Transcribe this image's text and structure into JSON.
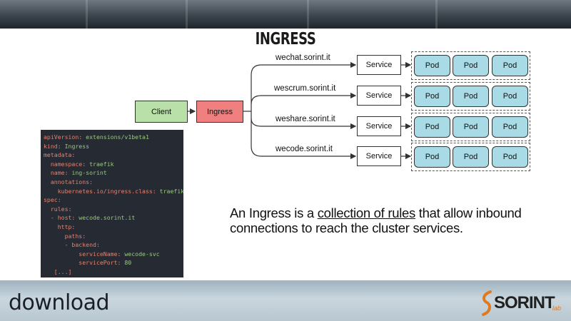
{
  "slide": {
    "title": "INGRESS",
    "description_before": "An Ingress is a ",
    "description_link": "collection of rules",
    "description_after": " that allow inbound connections to reach the cluster services."
  },
  "diagram": {
    "client_label": "Client",
    "ingress_label": "Ingress",
    "routes": [
      {
        "host": "wechat.sorint.it",
        "service": "Service",
        "pods": [
          "Pod",
          "Pod",
          "Pod"
        ]
      },
      {
        "host": "wescrum.sorint.it",
        "service": "Service",
        "pods": [
          "Pod",
          "Pod",
          "Pod"
        ]
      },
      {
        "host": "weshare.sorint.it",
        "service": "Service",
        "pods": [
          "Pod",
          "Pod",
          "Pod"
        ]
      },
      {
        "host": "wecode.sorint.it",
        "service": "Service",
        "pods": [
          "Pod",
          "Pod",
          "Pod"
        ]
      }
    ],
    "colors": {
      "client": "#b8e0a8",
      "ingress": "#f07f7f",
      "pod": "#a9dbe7"
    }
  },
  "yaml": [
    {
      "indent": "",
      "key": "apiVersion:",
      "value": " extensions/v1beta1"
    },
    {
      "indent": "",
      "key": "kind:",
      "value": " Ingress"
    },
    {
      "indent": "",
      "key": "metadata:",
      "value": ""
    },
    {
      "indent": "  ",
      "key": "namespace:",
      "value": " traefik"
    },
    {
      "indent": "  ",
      "key": "name:",
      "value": " ing-sorint"
    },
    {
      "indent": "  ",
      "key": "annotations:",
      "value": ""
    },
    {
      "indent": "    ",
      "key": "kubernetes.io/ingress.class:",
      "value": " traefik"
    },
    {
      "indent": "",
      "key": "spec:",
      "value": ""
    },
    {
      "indent": "  ",
      "key": "rules:",
      "value": ""
    },
    {
      "indent": "  ",
      "key": "- host:",
      "value": " wecode.sorint.it"
    },
    {
      "indent": "    ",
      "key": "http:",
      "value": ""
    },
    {
      "indent": "      ",
      "key": "paths:",
      "value": ""
    },
    {
      "indent": "      ",
      "key": "- backend:",
      "value": ""
    },
    {
      "indent": "          ",
      "key": "serviceName:",
      "value": " wecode-svc"
    },
    {
      "indent": "          ",
      "key": "servicePort:",
      "value": " 80"
    },
    {
      "indent": "   ",
      "key": "[...]",
      "value": ""
    }
  ],
  "branding": {
    "left_logo": "download",
    "right_logo": "SORINT",
    "right_logo_suffix": "lab"
  }
}
